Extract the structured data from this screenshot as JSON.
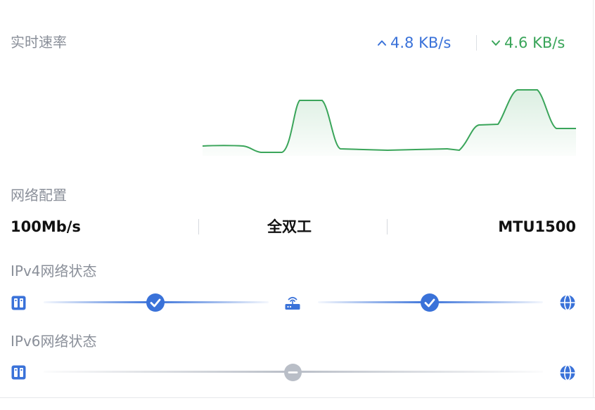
{
  "rate": {
    "title": "实时速率",
    "upload": "4.8 KB/s",
    "download": "4.6 KB/s",
    "upload_icon": "arrow-up-icon",
    "download_icon": "arrow-down-icon",
    "upload_color": "#3a72d9",
    "download_color": "#3aa55a"
  },
  "network": {
    "title": "网络配置",
    "speed": "100Mb/s",
    "duplex": "全双工",
    "mtu": "MTU1500"
  },
  "ipv4": {
    "title": "IPv4网络状态",
    "nodes": [
      "device-icon",
      "router-icon",
      "globe-icon"
    ],
    "links": [
      "ok",
      "ok"
    ]
  },
  "ipv6": {
    "title": "IPv6网络状态",
    "nodes": [
      "device-icon",
      "globe-icon"
    ],
    "links": [
      "unavailable"
    ]
  },
  "colors": {
    "accent_blue": "#3a72d9",
    "status_gray": "#b9bec7",
    "chart_green": "#3aa55a"
  }
}
